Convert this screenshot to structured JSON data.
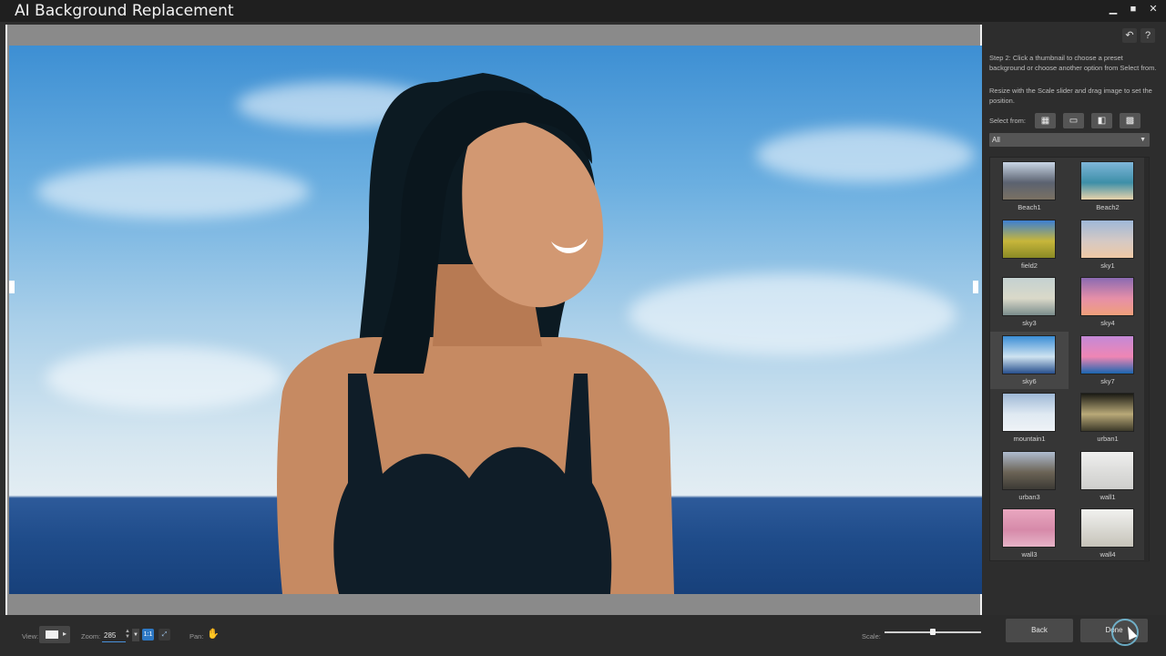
{
  "window": {
    "title": "AI Background Replacement",
    "controls": [
      "minimize-icon",
      "maximize-icon",
      "close-icon"
    ]
  },
  "panel": {
    "top_icons": [
      "undo-icon",
      "help-icon"
    ],
    "help_glyph": "?",
    "instructions": "Step 2: Click a thumbnail to choose a preset background or choose another option from Select from.",
    "instructions2": "Resize with the Scale slider and drag image to set the position.",
    "select_from_label": "Select from:",
    "select_from_buttons": [
      "preset-backgrounds-icon",
      "folder-icon",
      "color-swatch-icon",
      "transparent-icon"
    ],
    "category_dropdown": "All",
    "thumbnails": [
      {
        "label": "Beach1",
        "colors": [
          "#c9d6e6",
          "#5b6270",
          "#7a7163"
        ]
      },
      {
        "label": "Beach2",
        "colors": [
          "#7fb6d9",
          "#3d8fa8",
          "#e8d3aa"
        ]
      },
      {
        "label": "field2",
        "colors": [
          "#3c7fd2",
          "#c7b63b",
          "#8a8a25"
        ]
      },
      {
        "label": "sky1",
        "colors": [
          "#9fb8d8",
          "#d5c9c4",
          "#efc9a5"
        ]
      },
      {
        "label": "sky3",
        "colors": [
          "#c4d1d1",
          "#dad9c9",
          "#7b8d8c"
        ]
      },
      {
        "label": "sky4",
        "colors": [
          "#8b6ab2",
          "#e68fa8",
          "#f0a07a"
        ]
      },
      {
        "label": "sky6",
        "colors": [
          "#3b8ed6",
          "#cfe3f0",
          "#274f8d"
        ]
      },
      {
        "label": "sky7",
        "colors": [
          "#c489d7",
          "#ef86b4",
          "#1a66b0"
        ]
      },
      {
        "label": "mountain1",
        "colors": [
          "#9fb9d6",
          "#dfe9f2",
          "#eef2f6"
        ]
      },
      {
        "label": "urban1",
        "colors": [
          "#1a1a14",
          "#b9a978",
          "#3d3a2a"
        ]
      },
      {
        "label": "urban3",
        "colors": [
          "#aebcd0",
          "#6b6355",
          "#3c3a35"
        ]
      },
      {
        "label": "wall1",
        "colors": [
          "#efefee",
          "#dcdcda",
          "#cfcfcd"
        ]
      },
      {
        "label": "wall3",
        "colors": [
          "#e9a7c0",
          "#d68aa9",
          "#e6b3c7"
        ]
      },
      {
        "label": "wall4",
        "colors": [
          "#f1f1ef",
          "#d9d8d2",
          "#c6c3b9"
        ]
      }
    ],
    "selected_thumbnail": "sky6"
  },
  "bottom": {
    "view_label": "View:",
    "zoom_label": "Zoom:",
    "zoom_value": "285",
    "zoom_actual_label": "1:1",
    "pan_label": "Pan:",
    "scale_label": "Scale:",
    "scale_fraction": 0.5,
    "back_label": "Back",
    "done_label": "Done"
  }
}
